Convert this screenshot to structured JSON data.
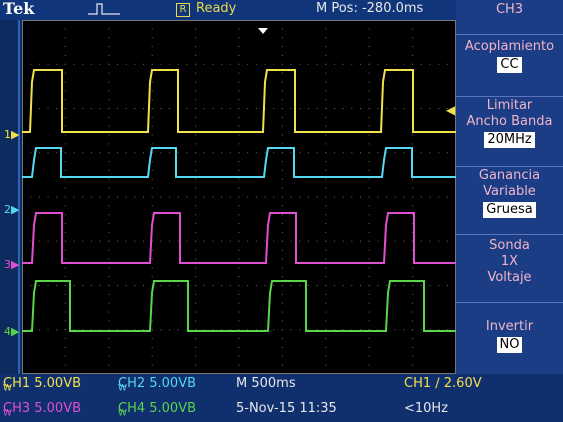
{
  "header": {
    "brand": "Tek",
    "trigger_icon": "trigger-pulse-icon",
    "status_letter": "R",
    "status": "Ready",
    "mpos": "M Pos: -280.0ms"
  },
  "side_menu": {
    "channel": "CH3",
    "coupling_label_1": "Acoplamiento",
    "coupling_value": "CC",
    "bw_label_1": "Limitar",
    "bw_label_2": "Ancho Banda",
    "bw_value": "20MHz",
    "gain_label_1": "Ganancia",
    "gain_label_2": "Variable",
    "gain_value": "Gruesa",
    "probe_label_1": "Sonda",
    "probe_label_2": "1X",
    "probe_label_3": "Voltaje",
    "invert_label": "Invertir",
    "invert_value": "NO"
  },
  "markers": {
    "ch1": "1",
    "ch2": "2",
    "ch3": "3",
    "ch4": "4"
  },
  "status_bar": {
    "ch1": "CH1  5.00VB",
    "ch1_suffix": "W",
    "ch2": "CH2  5.00VB",
    "ch2_suffix": "W",
    "ch3": "CH3  5.00VB",
    "ch3_suffix": "W",
    "ch4": "CH4  5.00VB",
    "ch4_suffix": "W",
    "timebase": "M 500ms",
    "date": "5-Nov-15 11:35",
    "trigger": "CH1  ∕  2.60V",
    "freq": "<10Hz"
  },
  "colors": {
    "ch1": "#f2e14a",
    "ch2": "#56d8f0",
    "ch3": "#e04fd0",
    "ch4": "#59d44b"
  }
}
